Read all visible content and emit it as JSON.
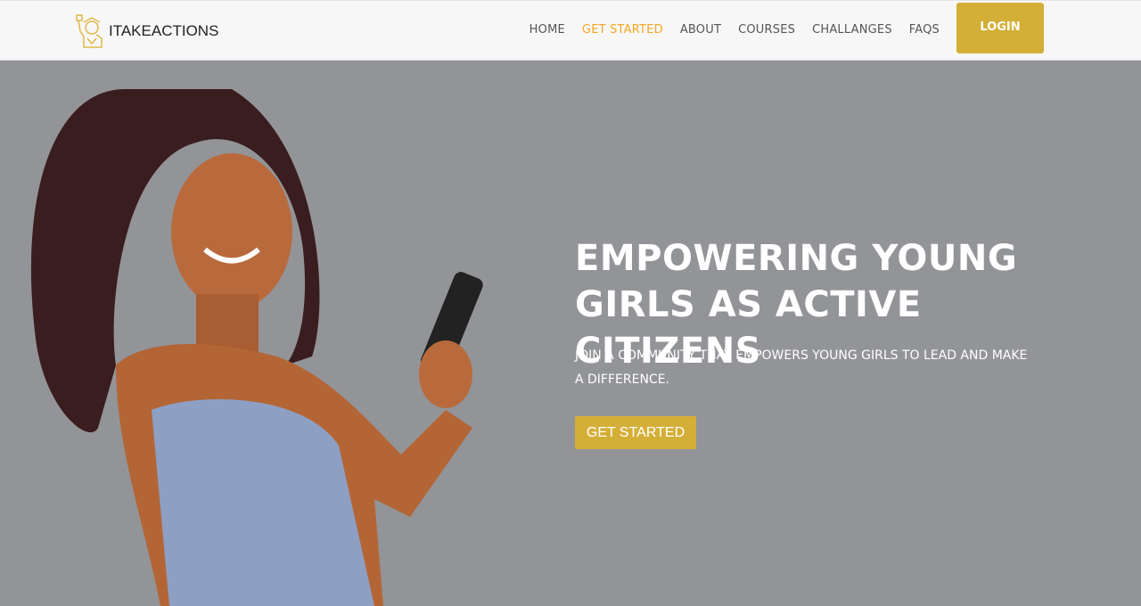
{
  "header": {
    "logo_text": "ITAKEACTIONS",
    "nav": [
      {
        "label": "HOME"
      },
      {
        "label": "GET STARTED",
        "active": true
      },
      {
        "label": "ABOUT"
      },
      {
        "label": "COURSES"
      },
      {
        "label": "CHALLANGES"
      },
      {
        "label": "FAQS"
      }
    ],
    "login_label": "LOGIN"
  },
  "hero": {
    "title": "EMPOWERING YOUNG GIRLS AS ACTIVE CITIZENS",
    "subtitle": "JOIN A COMMUNITY THAT EMPOWERS YOUNG GIRLS TO LEAD AND MAKE A DIFFERENCE.",
    "cta_label": "GET STARTED",
    "image": "smiling-woman-holding-phone"
  },
  "colors": {
    "accent": "#d4af37",
    "active_nav": "#f5a623",
    "hero_bg": "#939498"
  }
}
